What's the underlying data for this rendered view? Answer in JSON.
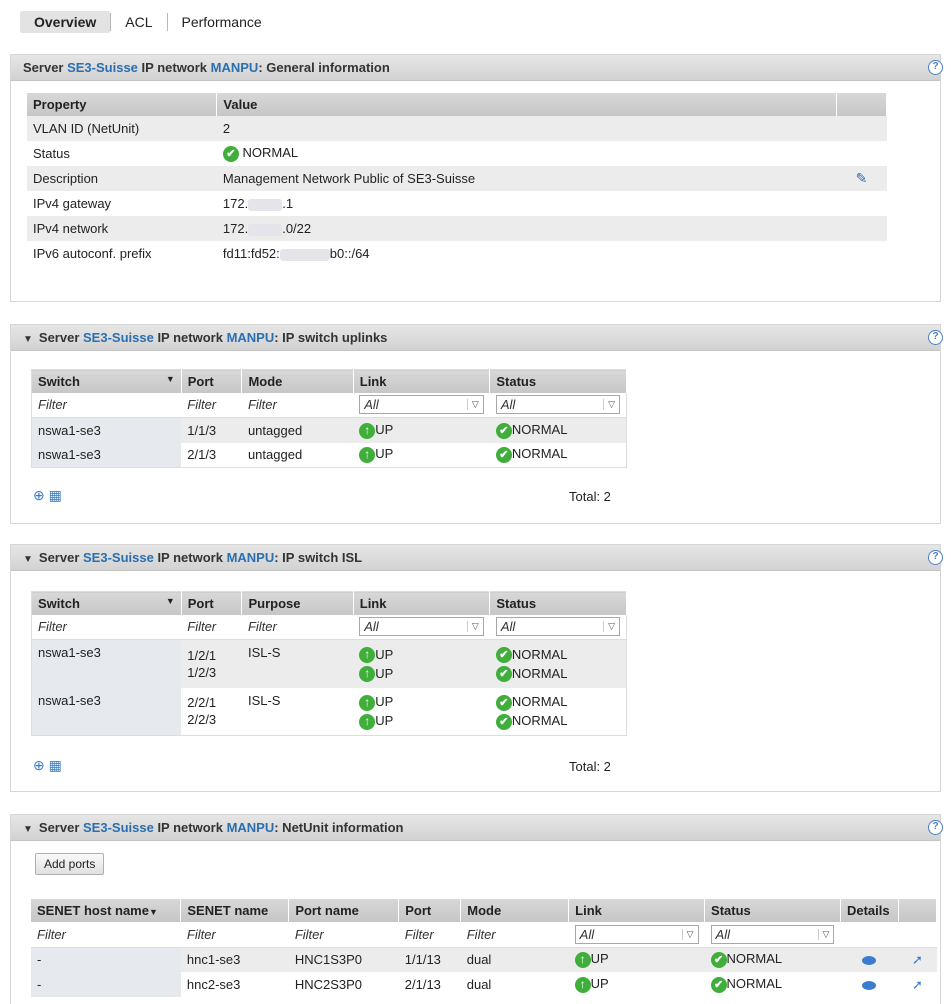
{
  "tabs": [
    "Overview",
    "ACL",
    "Performance"
  ],
  "panels": {
    "general": {
      "prefix": "Server ",
      "server": "SE3-Suisse",
      "mid": " IP network ",
      "network": "MANPU",
      "title": ": General information",
      "headers": [
        "Property",
        "Value"
      ],
      "rows": [
        {
          "property": "VLAN ID (NetUnit)",
          "value": "2"
        },
        {
          "property": "Status",
          "value": "NORMAL"
        },
        {
          "property": "Description",
          "value": "Management Network Public of SE3-Suisse"
        },
        {
          "property": "IPv4 gateway",
          "value_a": "172.",
          "value_b": ".1"
        },
        {
          "property": "IPv4 network",
          "value_a": "172.",
          "value_b": ".0/22"
        },
        {
          "property": "IPv6 autoconf. prefix",
          "value_a": "fd11:fd52:",
          "value_b": "b0::/64"
        }
      ]
    },
    "uplinks": {
      "prefix": "Server ",
      "server": "SE3-Suisse",
      "mid": " IP network ",
      "network": "MANPU",
      "title": ": IP switch uplinks",
      "headers": [
        "Switch",
        "Port",
        "Mode",
        "Link",
        "Status"
      ],
      "filters": [
        "Filter",
        "Filter",
        "Filter",
        "All",
        "All"
      ],
      "rows": [
        {
          "switch": "nswa1-se3",
          "port": "1/1/3",
          "mode": "untagged",
          "link": "UP",
          "status": "NORMAL"
        },
        {
          "switch": "nswa1-se3",
          "port": "2/1/3",
          "mode": "untagged",
          "link": "UP",
          "status": "NORMAL"
        }
      ],
      "total": "Total: 2"
    },
    "isl": {
      "prefix": "Server ",
      "server": "SE3-Suisse",
      "mid": " IP network ",
      "network": "MANPU",
      "title": ": IP switch ISL",
      "headers": [
        "Switch",
        "Port",
        "Purpose",
        "Link",
        "Status"
      ],
      "filters": [
        "Filter",
        "Filter",
        "Filter",
        "All",
        "All"
      ],
      "rows": [
        {
          "switch": "nswa1-se3",
          "port1": "1/2/1",
          "port2": "1/2/3",
          "purpose": "ISL-S",
          "link1": "UP",
          "link2": "UP",
          "status1": "NORMAL",
          "status2": "NORMAL"
        },
        {
          "switch": "nswa1-se3",
          "port1": "2/2/1",
          "port2": "2/2/3",
          "purpose": "ISL-S",
          "link1": "UP",
          "link2": "UP",
          "status1": "NORMAL",
          "status2": "NORMAL"
        }
      ],
      "total": "Total: 2"
    },
    "netunit": {
      "prefix": "Server ",
      "server": "SE3-Suisse",
      "mid": " IP network ",
      "network": "MANPU",
      "title": ": NetUnit information",
      "add_ports": "Add ports",
      "headers": [
        "SENET host name",
        "SENET name",
        "Port name",
        "Port",
        "Mode",
        "Link",
        "Status",
        "Details"
      ],
      "filters": [
        "Filter",
        "Filter",
        "Filter",
        "Filter",
        "Filter",
        "All",
        "All"
      ],
      "rows": [
        {
          "host": "-",
          "senet": "hnc1-se3",
          "portname": "HNC1S3P0",
          "port": "1/1/13",
          "mode": "dual",
          "link": "UP",
          "status": "NORMAL"
        },
        {
          "host": "-",
          "senet": "hnc2-se3",
          "portname": "HNC2S3P0",
          "port": "2/1/13",
          "mode": "dual",
          "link": "UP",
          "status": "NORMAL"
        }
      ]
    }
  },
  "icons": {
    "help": "?",
    "check": "✔",
    "up": "↑"
  }
}
